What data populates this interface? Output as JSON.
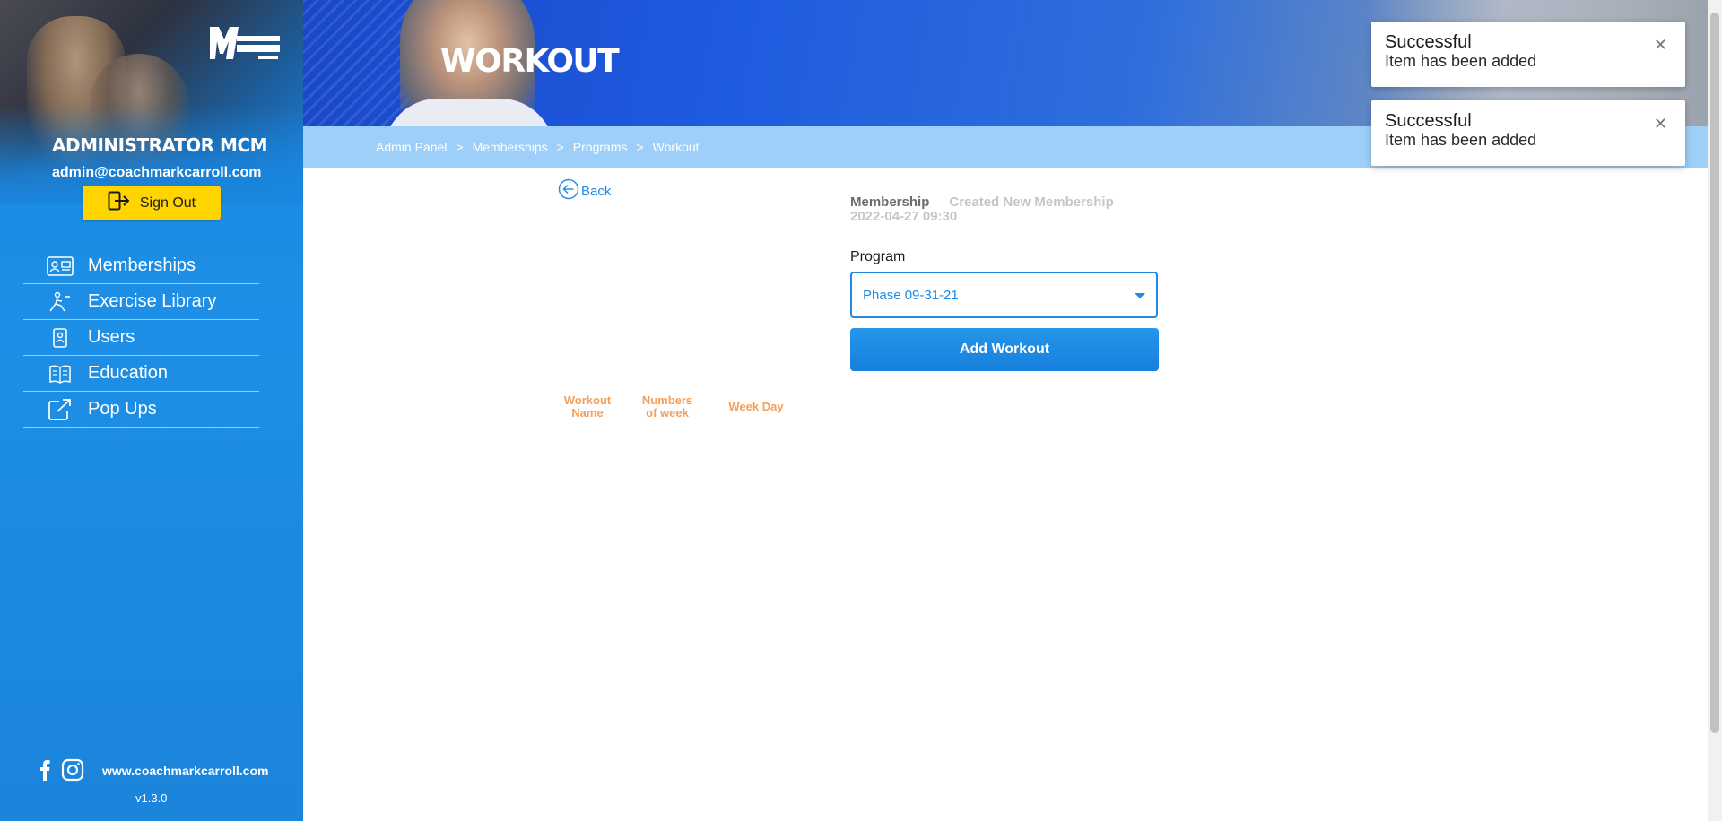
{
  "sidebar": {
    "admin_name": "ADMINISTRATOR MCM",
    "admin_email": "admin@coachmarkcarroll.com",
    "signout_label": "Sign Out",
    "nav": [
      {
        "label": "Memberships",
        "icon": "id-card-icon"
      },
      {
        "label": "Exercise Library",
        "icon": "exercise-icon"
      },
      {
        "label": "Users",
        "icon": "user-badge-icon"
      },
      {
        "label": "Education",
        "icon": "book-icon"
      },
      {
        "label": "Pop Ups",
        "icon": "external-link-icon"
      }
    ],
    "footer": {
      "website": "www.coachmarkcarroll.com",
      "version": "v1.3.0"
    }
  },
  "header": {
    "title": "WORKOUT",
    "breadcrumb": [
      "Admin Panel",
      "Memberships",
      "Programs",
      "Workout"
    ]
  },
  "main": {
    "back_label": "Back",
    "membership": {
      "label": "Membership",
      "name": "Created New Membership",
      "date": "2022-04-27 09:30"
    },
    "program": {
      "label": "Program",
      "selected": "Phase 09-31-21"
    },
    "add_workout_label": "Add Workout",
    "table_headers": [
      "Workout Name",
      "Numbers of week",
      "Week Day"
    ]
  },
  "toasts": [
    {
      "title": "Successful",
      "message": "Item has been added"
    },
    {
      "title": "Successful",
      "message": "Item has been added"
    }
  ],
  "colors": {
    "primary": "#1e8fe6",
    "accent_yellow": "#ffd400",
    "table_header_orange": "#f4a05a",
    "breadcrumb_bg": "#9dcff8"
  }
}
